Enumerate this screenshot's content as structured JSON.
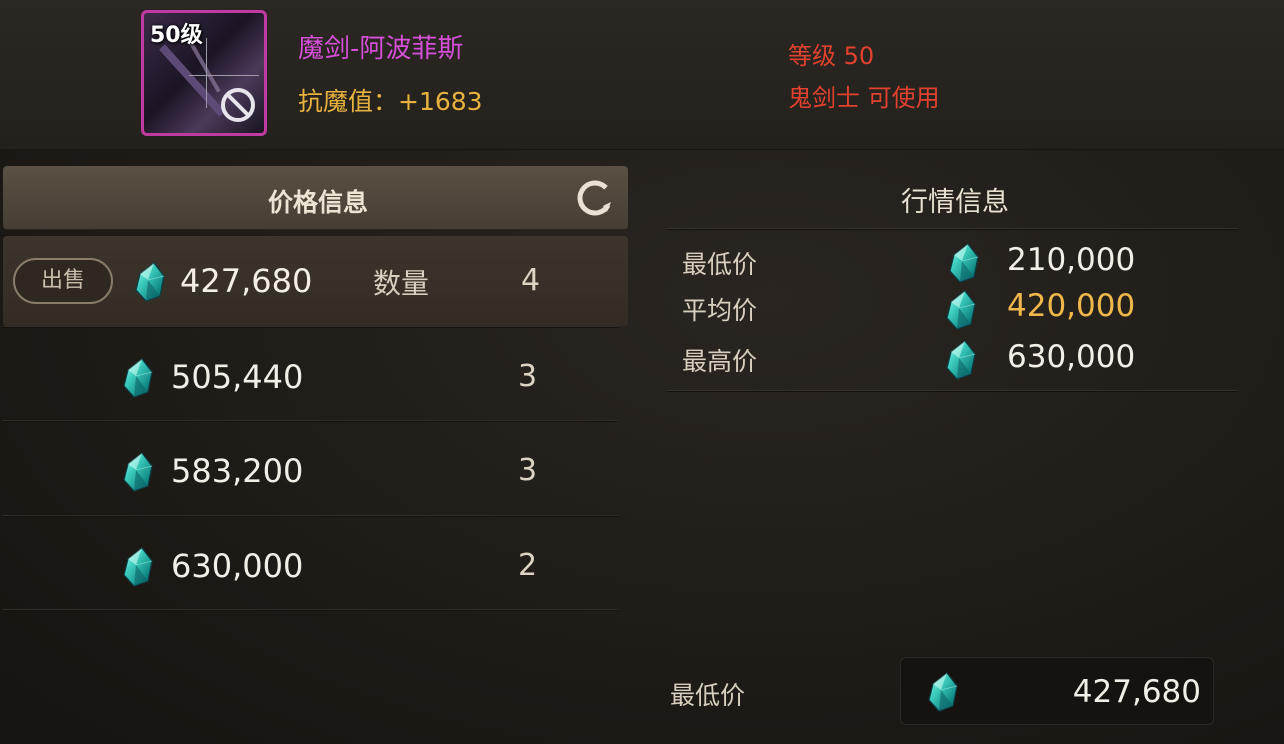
{
  "item": {
    "level_badge": "50级",
    "name": "魔剑-阿波菲斯",
    "stat": "抗魔值：+1683",
    "required_level": "等级 50",
    "required_class": "鬼剑士 可使用",
    "name_color": "#d64fd8",
    "border_color": "#c03aa2",
    "icons": [
      "sword-art-icon",
      "ban-icon"
    ]
  },
  "price_panel": {
    "title": "价格信息",
    "refresh_icon": "refresh-icon",
    "sell_label": "出售",
    "quantity_label": "数量",
    "currency_icon": "gem-icon",
    "listings": [
      {
        "price": "427,680",
        "qty": "4"
      },
      {
        "price": "505,440",
        "qty": "3"
      },
      {
        "price": "583,200",
        "qty": "3"
      },
      {
        "price": "630,000",
        "qty": "2"
      }
    ]
  },
  "market_panel": {
    "title": "行情信息",
    "rows": [
      {
        "label": "最低价",
        "value": "210,000"
      },
      {
        "label": "平均价",
        "value": "420,000"
      },
      {
        "label": "最高价",
        "value": "630,000"
      }
    ],
    "highlight_color": "#f0b84a"
  },
  "footer": {
    "label": "最低价",
    "value": "427,680"
  }
}
